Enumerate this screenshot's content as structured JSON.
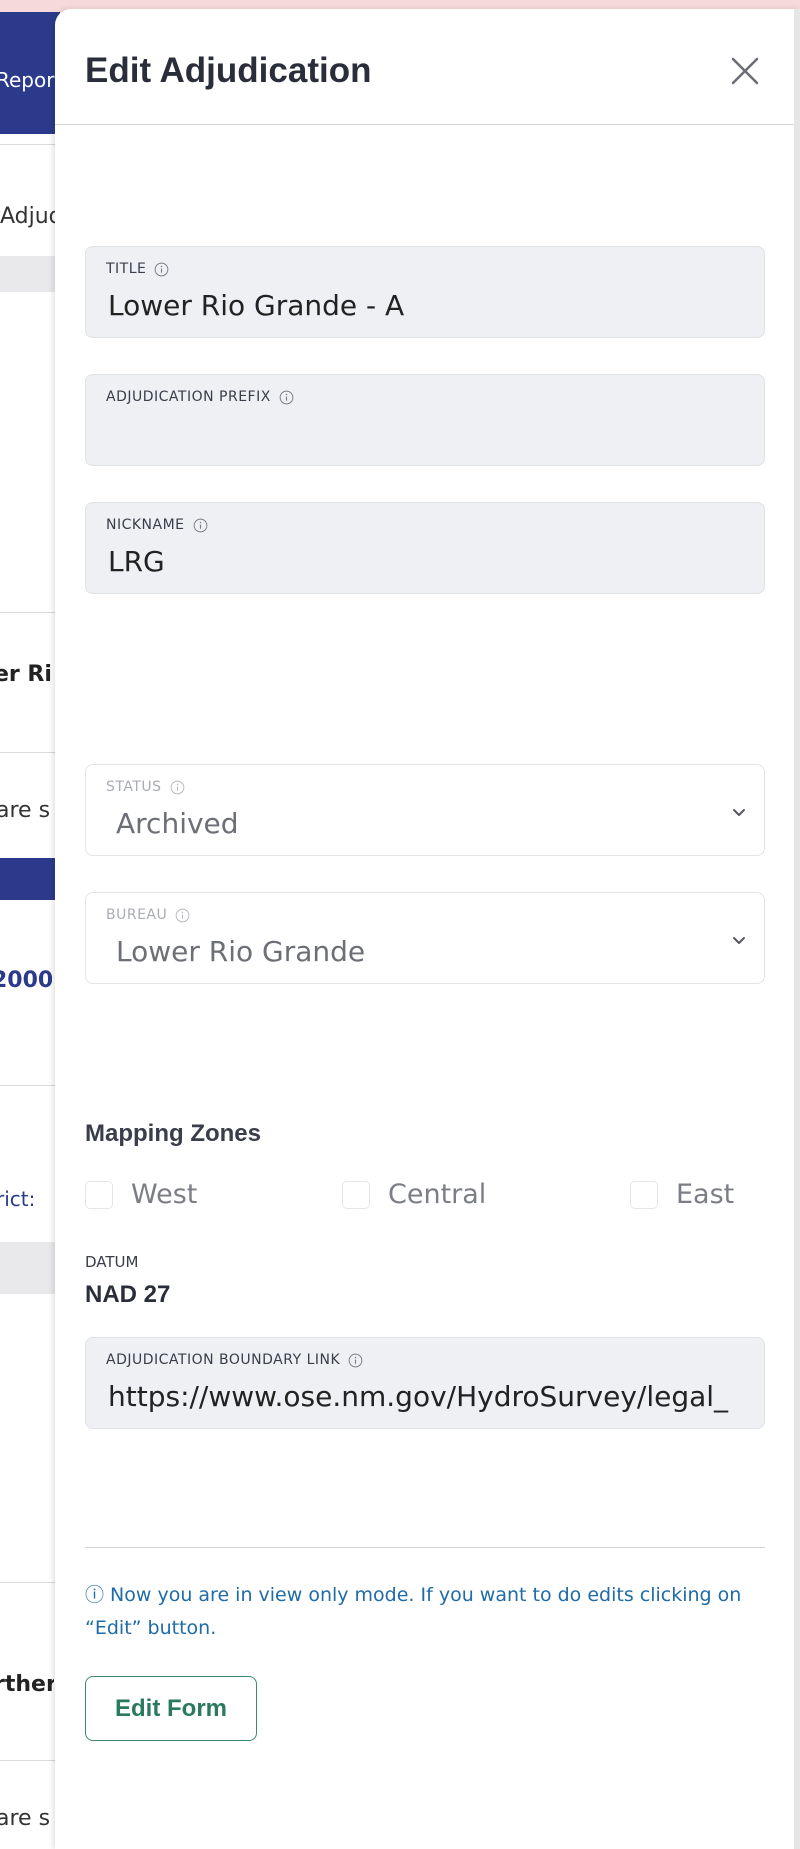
{
  "background": {
    "header_text": "Repor",
    "rows": [
      "Adjudic",
      "er Ri",
      "are s",
      "2000",
      "rict:",
      "rther",
      "are s"
    ]
  },
  "panel": {
    "title": "Edit Adjudication",
    "fields": {
      "title": {
        "label": "TITLE",
        "value": "Lower Rio Grande - A"
      },
      "prefix": {
        "label": "ADJUDICATION PREFIX",
        "value": ""
      },
      "nickname": {
        "label": "NICKNAME",
        "value": "LRG"
      },
      "status": {
        "label": "STATUS",
        "value": "Archived"
      },
      "bureau": {
        "label": "BUREAU",
        "value": "Lower Rio Grande"
      },
      "boundary_link": {
        "label": "ADJUDICATION BOUNDARY LINK",
        "value": "https://www.ose.nm.gov/HydroSurvey/legal_"
      }
    },
    "mapping_zones": {
      "title": "Mapping Zones",
      "zones": [
        "West",
        "Central",
        "East"
      ]
    },
    "datum": {
      "label": "DATUM",
      "value": "NAD 27"
    },
    "note": "ⓘ Now you are in view only mode. If you want to do edits clicking on “Edit” button.",
    "edit_button": "Edit Form"
  },
  "colors": {
    "accent_navy": "#2c3a8c",
    "note_blue": "#1e6ba8",
    "button_green": "#2a7a5f",
    "field_bg": "#eef0f3"
  }
}
